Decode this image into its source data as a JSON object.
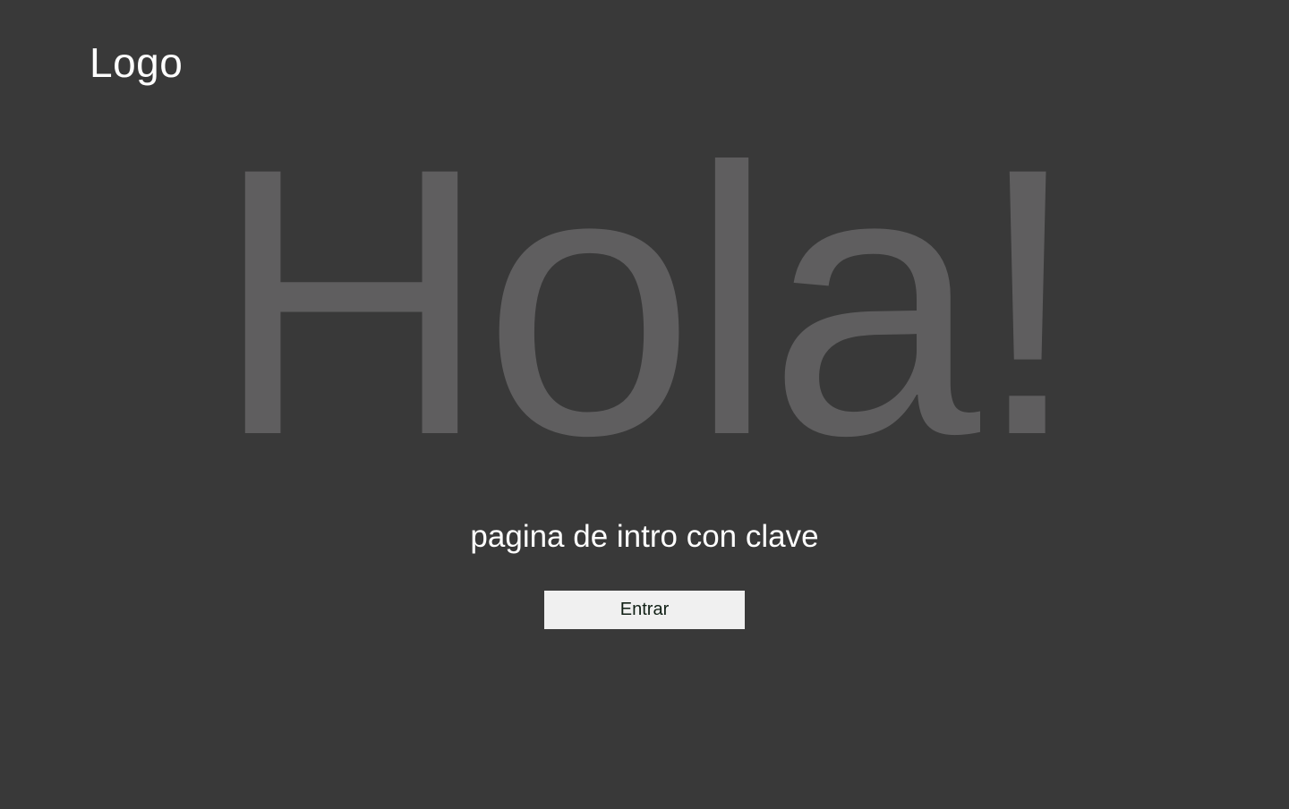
{
  "header": {
    "logo_text": "Logo"
  },
  "hero": {
    "title": "Hola!",
    "subtitle": "pagina de intro con clave"
  },
  "actions": {
    "enter_label": "Entrar"
  },
  "colors": {
    "background": "#393939",
    "hero_text": "#5f5e5f",
    "text": "#ffffff",
    "button_bg": "#f0f0f0",
    "button_text": "#102015"
  }
}
